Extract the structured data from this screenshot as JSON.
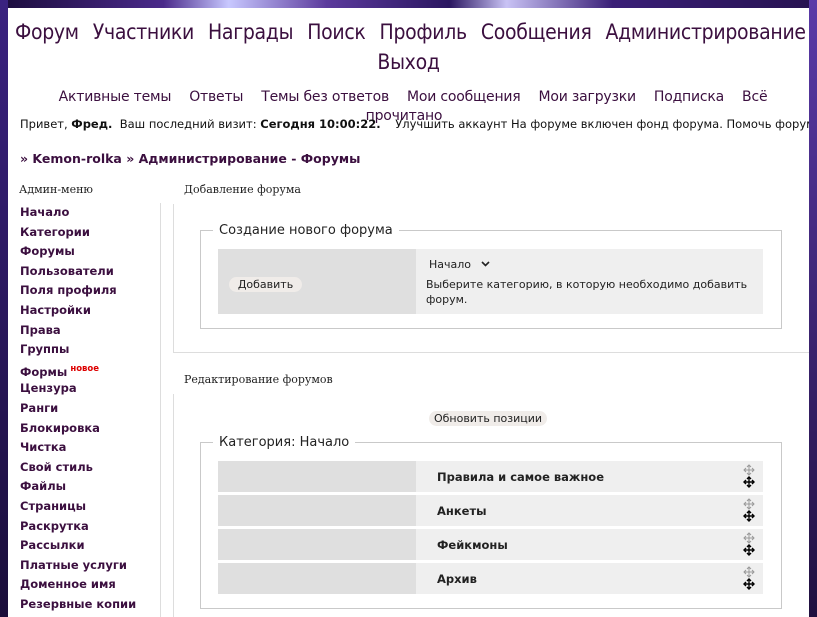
{
  "main_nav": [
    "Форум",
    "Участники",
    "Награды",
    "Поиск",
    "Профиль",
    "Сообщения",
    "Администрирование",
    "Выход"
  ],
  "sub_nav": [
    "Активные темы",
    "Ответы",
    "Темы без ответов",
    "Мои сообщения",
    "Мои загрузки",
    "Подписка",
    "Всё прочитано"
  ],
  "greeting": {
    "hello": "Привет, ",
    "user": "Фред.",
    "last_visit_label": "  Ваш последний визит: ",
    "last_visit": "Сегодня 10:00:22.",
    "upgrade": "    Улучшить аккаунт ",
    "fund": "На форуме включен фонд форума. Помочь форуму."
  },
  "breadcrumb": "» Kemon-rolka » Администрирование - Форумы",
  "sidebar": {
    "title": "Админ-меню",
    "items": [
      "Начало",
      "Категории",
      "Форумы",
      "Пользователи",
      "Поля профиля",
      "Настройки",
      "Права",
      "Группы",
      "Формы",
      "Цензура",
      "Ранги",
      "Блокировка",
      "Чистка",
      "Свой стиль",
      "Файлы",
      "Страницы",
      "Раскрутка",
      "Рассылки",
      "Платные услуги",
      "Доменное имя",
      "Резервные копии"
    ],
    "new_badge": "новое"
  },
  "add_forum": {
    "section_title": "Добавление форума",
    "legend": "Создание нового форума",
    "button": "Добавить",
    "category_select": "Начало",
    "help": "Выберите категорию, в которую необходимо добавить форум."
  },
  "edit_forums": {
    "section_title": "Редактирование форумов",
    "update_button": "Обновить позиции",
    "legend": "Категория: Начало",
    "forums": [
      "Правила и самое важное",
      "Анкеты",
      "Фейкмоны",
      "Архив"
    ]
  }
}
